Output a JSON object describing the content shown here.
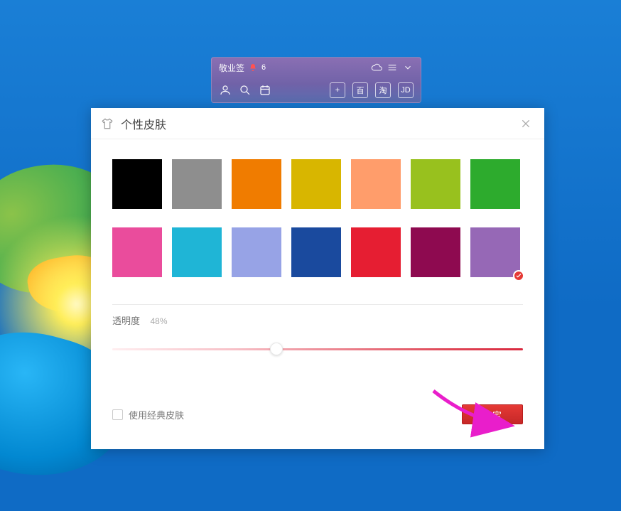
{
  "mini": {
    "app_name": "敬业签",
    "notif_count": "6",
    "right_buttons": [
      "+",
      "百",
      "淘",
      "JD"
    ]
  },
  "dialog": {
    "title": "个性皮肤",
    "swatches_row1": [
      "#000000",
      "#8e8e8e",
      "#f07c00",
      "#d8b600",
      "#ff9d6b",
      "#98c11e",
      "#2dab2d"
    ],
    "swatches_row2": [
      "#ea4c9c",
      "#1fb5d6",
      "#97a3e6",
      "#1a4a9e",
      "#e61e32",
      "#8e0a50",
      "#9668b6"
    ],
    "selected_index": 13,
    "opacity_label": "透明度",
    "opacity_value": "48%",
    "opacity_percent": 40,
    "classic_checkbox_label": "使用经典皮肤",
    "classic_checked": false,
    "confirm_label": "确定"
  }
}
